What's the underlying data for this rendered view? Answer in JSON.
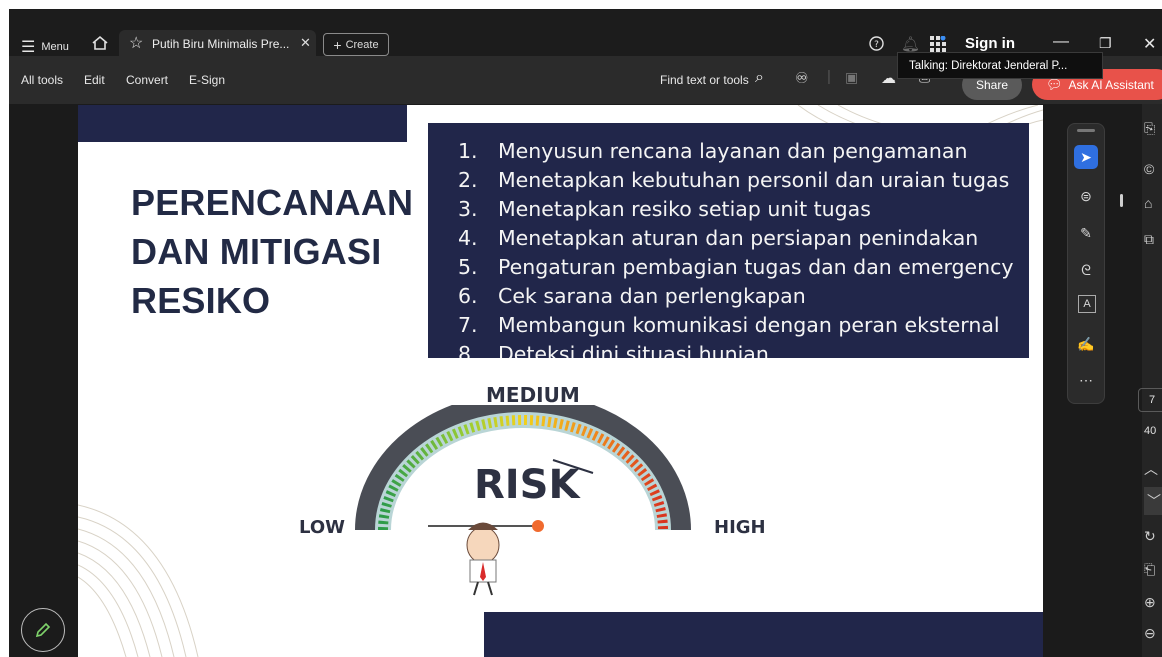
{
  "window": {
    "menu_label": "Menu",
    "tab_title": "Putih Biru Minimalis Pre...",
    "create_label": "Create",
    "sign_in_label": "Sign in",
    "tooltip": "Talking: Direktorat Jenderal P..."
  },
  "toolbar": {
    "all_tools": "All tools",
    "edit": "Edit",
    "convert": "Convert",
    "esign": "E-Sign",
    "find_placeholder": "Find text or tools",
    "share_label": "Share",
    "ai_label": "Ask AI Assistant"
  },
  "slide": {
    "heading_lines": [
      "PERENCANAAN",
      "DAN MITIGASI",
      "RESIKO"
    ],
    "list": [
      {
        "num": "1.",
        "text": "Menyusun rencana layanan dan pengamanan"
      },
      {
        "num": "2.",
        "text": "Menetapkan kebutuhan personil dan uraian tugas"
      },
      {
        "num": "3.",
        "text": "Menetapkan resiko setiap unit tugas"
      },
      {
        "num": "4.",
        "text": "Menetapkan aturan dan persiapan  penindakan"
      },
      {
        "num": "5.",
        "text": "Pengaturan pembagian tugas dan dan emergency"
      },
      {
        "num": "6.",
        "text": "Cek sarana dan perlengkapan"
      },
      {
        "num": "7.",
        "text": "Membangun komunikasi dengan peran eksternal"
      },
      {
        "num": "8.",
        "text": "Deteksi dini situasi hunian"
      }
    ],
    "gauge": {
      "medium": "MEDIUM",
      "risk": "RISK",
      "low": "LOW",
      "high": "HIGH"
    }
  },
  "sidebar": {
    "page_number": "7",
    "page_total": "40"
  },
  "colors": {
    "navy": "#21264a",
    "accent_blue": "#2f6fe0",
    "ai_button": "#e8524a"
  }
}
